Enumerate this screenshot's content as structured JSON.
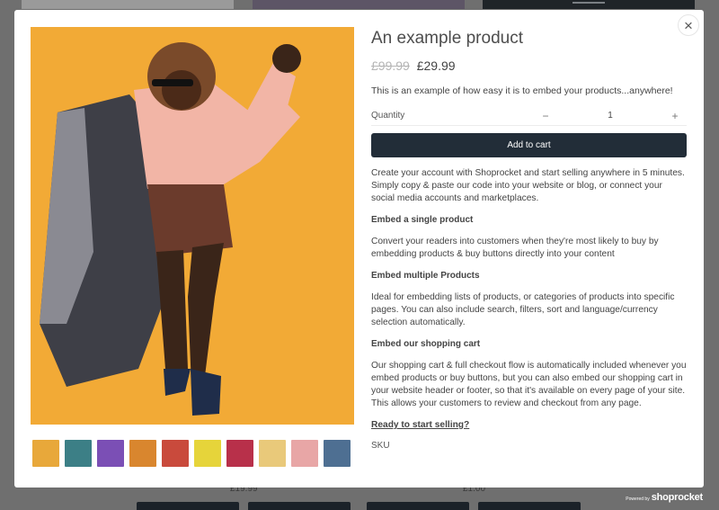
{
  "background": {
    "prices": [
      "£19.99",
      "£1.00"
    ]
  },
  "modal": {
    "close_label": "×",
    "title": "An example product",
    "price_old": "£99.99",
    "price_new": "£29.99",
    "short_description": "This is an example of how easy it is to embed your products...anywhere!",
    "quantity": {
      "label": "Quantity",
      "minus": "−",
      "value": "1",
      "plus": "+"
    },
    "add_to_cart_label": "Add to cart",
    "body": {
      "intro": "Create your account with Shoprocket and start selling anywhere in 5 minutes. Simply copy & paste our code into your website or blog, or connect your social media accounts and marketplaces.",
      "h1": "Embed a single product",
      "p1": "Convert your readers into customers when they're most likely to buy by embedding products & buy buttons directly into your content",
      "h2": "Embed multiple Products",
      "p2": "Ideal for embedding lists of products, or categories of products into specific pages. You can also include search, filters, sort and language/currency selection automatically.",
      "h3": "Embed our shopping cart",
      "p3": "Our shopping cart & full checkout flow is automatically included whenever you embed products or buy buttons, but you can also embed our shopping cart in your website header or footer, so that it's available on every page of your site. This allows your customers to review and checkout from any page.",
      "cta_link": "Ready to start selling?"
    },
    "sku_label": "SKU",
    "thumbnails": [
      {
        "name": "thumb-1",
        "color": "#e8a83a"
      },
      {
        "name": "thumb-2",
        "color": "#3c7f86"
      },
      {
        "name": "thumb-3",
        "color": "#7b4fb5"
      },
      {
        "name": "thumb-4",
        "color": "#d9862e"
      },
      {
        "name": "thumb-5",
        "color": "#c94a3c"
      },
      {
        "name": "thumb-6",
        "color": "#e6d43a"
      },
      {
        "name": "thumb-7",
        "color": "#b8304a"
      },
      {
        "name": "thumb-8",
        "color": "#e9c97a"
      },
      {
        "name": "thumb-9",
        "color": "#e8a6a6"
      },
      {
        "name": "thumb-10",
        "color": "#4e6f92"
      }
    ]
  },
  "footer": {
    "powered_small": "Powered by",
    "powered_brand": "shoprocket"
  }
}
